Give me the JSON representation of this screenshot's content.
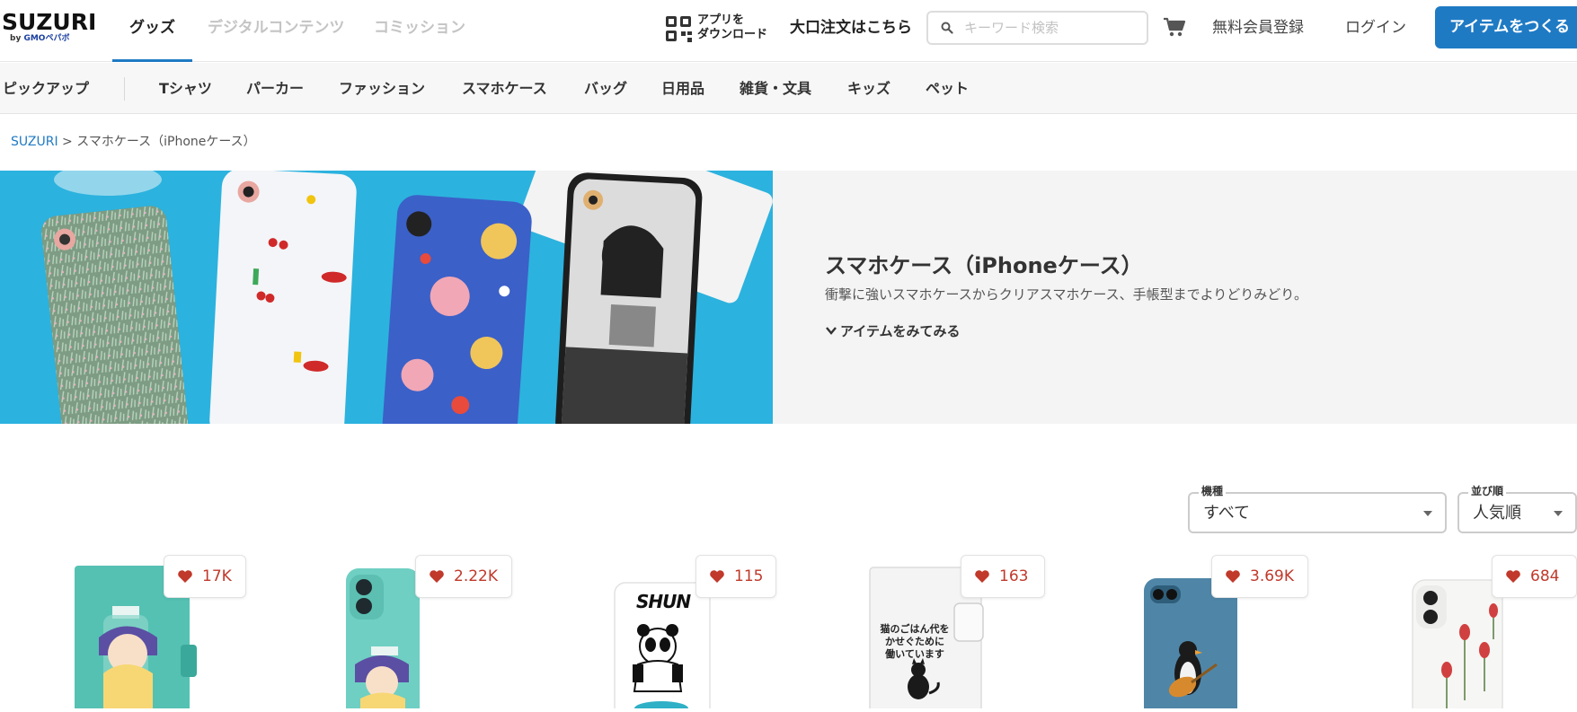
{
  "header": {
    "logo_text": "SUZURI",
    "logo_sub_by": "by",
    "logo_sub_gmo": "GMO",
    "logo_sub_pepabo": "ペパボ",
    "tabs": [
      {
        "label": "グッズ",
        "active": true
      },
      {
        "label": "デジタルコンテンツ",
        "active": false
      },
      {
        "label": "コミッション",
        "active": false
      }
    ],
    "app_download_line1": "アプリを",
    "app_download_line2": "ダウンロード",
    "bulk_order": "大口注文はこちら",
    "search_placeholder": "キーワード検索",
    "register": "無料会員登録",
    "login": "ログイン",
    "create_button": "アイテムをつくる",
    "accent_color": "#1f7ac4"
  },
  "categories": [
    "ピックアップ",
    "Tシャツ",
    "パーカー",
    "ファッション",
    "スマホケース",
    "バッグ",
    "日用品",
    "雑貨・文具",
    "キッズ",
    "ペット"
  ],
  "breadcrumb": {
    "root": "SUZURI",
    "separator": ">",
    "current": "スマホケース（iPhoneケース）"
  },
  "hero": {
    "title": "スマホケース（iPhoneケース）",
    "description": "衝撃に強いスマホケースからクリアスマホケース、手帳型までよりどりみどり。",
    "link": "アイテムをみてみる"
  },
  "filters": {
    "model_label": "機種",
    "model_value": "すべて",
    "sort_label": "並び順",
    "sort_value": "人気順"
  },
  "products": [
    {
      "likes": "17K",
      "design": "teal-notebook-anime"
    },
    {
      "likes": "2.22K",
      "design": "teal-case-anime"
    },
    {
      "likes": "115",
      "design": "panda-shun",
      "print_text": "SHUN"
    },
    {
      "likes": "163",
      "design": "white-notebook-cat",
      "print_text_lines": [
        "猫のごはん代を",
        "かせぐために",
        "働いています"
      ]
    },
    {
      "likes": "3.69K",
      "design": "blue-penguin-guitar"
    },
    {
      "likes": "684",
      "design": "white-tulips"
    }
  ],
  "icons": {
    "search": "search-icon",
    "cart": "cart-icon",
    "qr": "qr-code-icon",
    "heart": "heart-icon",
    "chevron": "chevron-down-icon"
  }
}
